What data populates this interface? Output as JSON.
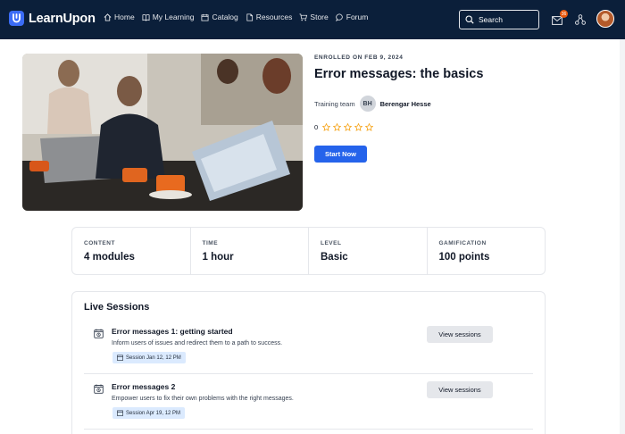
{
  "brand": {
    "name": "LearnUpon"
  },
  "nav": [
    {
      "label": "Home",
      "icon": "home-icon"
    },
    {
      "label": "My Learning",
      "icon": "book-icon"
    },
    {
      "label": "Catalog",
      "icon": "catalog-icon"
    },
    {
      "label": "Resources",
      "icon": "document-icon"
    },
    {
      "label": "Store",
      "icon": "cart-icon"
    },
    {
      "label": "Forum",
      "icon": "chat-icon"
    }
  ],
  "search": {
    "label": "Search"
  },
  "notifications": {
    "count": "36"
  },
  "course": {
    "enrolled": "ENROLLED ON FEB 9, 2024",
    "title": "Error messages: the basics",
    "trainer_label": "Training team",
    "trainer_initials": "BH",
    "trainer_name": "Berengar Hesse",
    "rating_count": "0",
    "stars": 0,
    "start_label": "Start Now"
  },
  "stats": [
    {
      "label": "CONTENT",
      "value": "4 modules"
    },
    {
      "label": "TIME",
      "value": "1 hour"
    },
    {
      "label": "LEVEL",
      "value": "Basic"
    },
    {
      "label": "GAMIFICATION",
      "value": "100 points"
    }
  ],
  "live_sessions": {
    "title": "Live Sessions",
    "items": [
      {
        "name": "Error messages 1: getting started",
        "description": "Inform users of issues and redirect them to a path to success.",
        "session": "Session Jan 12, 12 PM",
        "button": "View sessions"
      },
      {
        "name": "Error messages 2",
        "description": "Empower users to fix their own problems with the right messages.",
        "session": "Session Apr 19, 12 PM",
        "button": "View sessions"
      }
    ]
  },
  "colors": {
    "navbar": "#0b1f3a",
    "primary": "#2563eb",
    "badge": "#ea580c",
    "star": "#f59e0b"
  }
}
